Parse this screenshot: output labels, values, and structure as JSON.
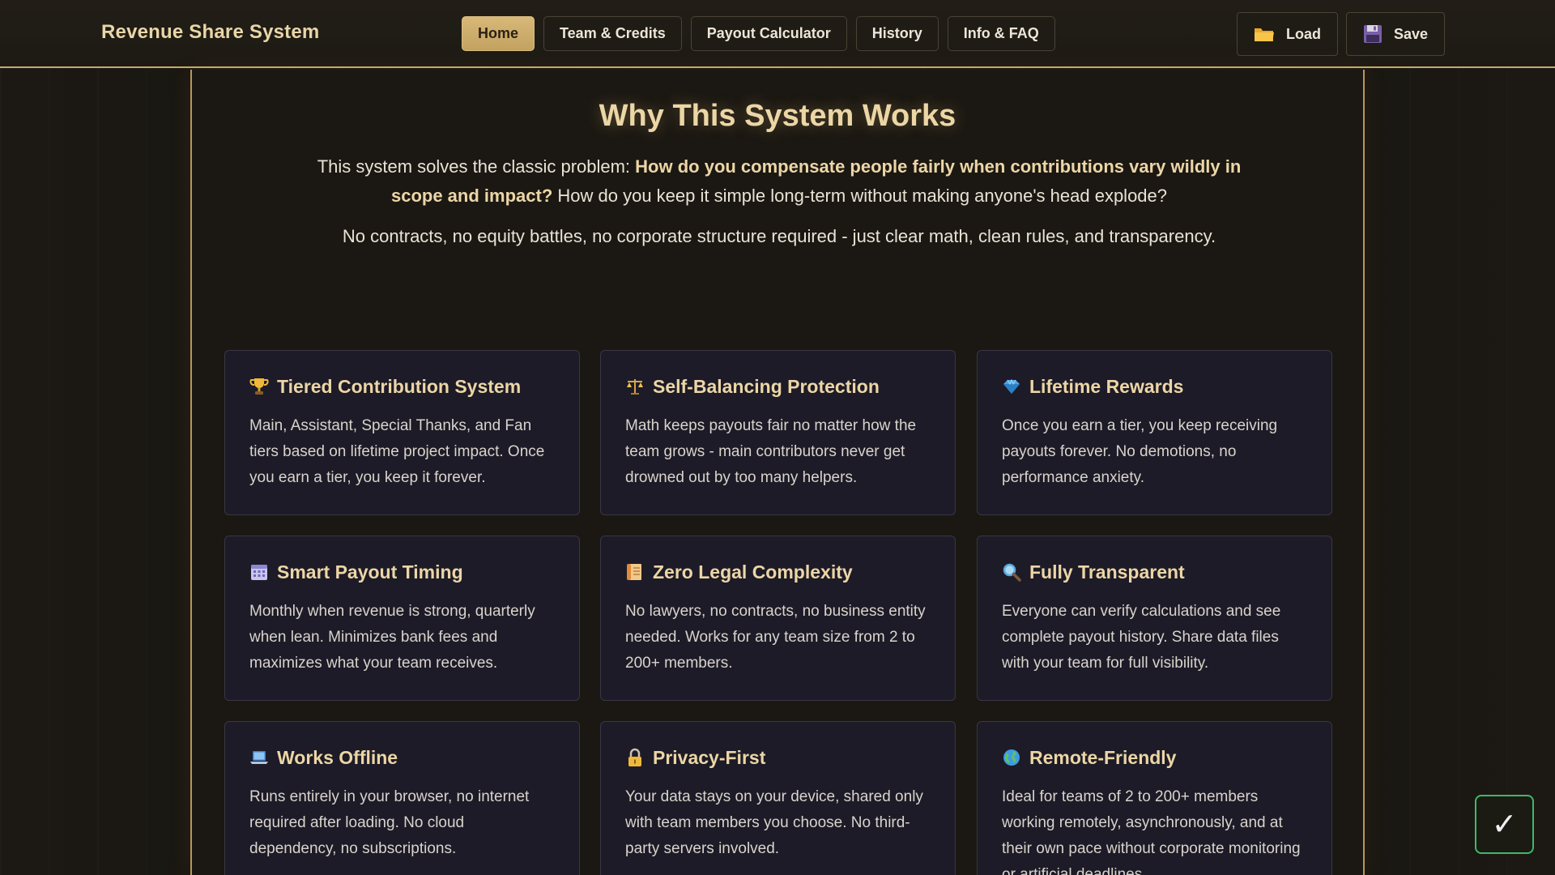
{
  "header": {
    "brand": "Revenue Share System",
    "nav": [
      {
        "label": "Home",
        "active": true
      },
      {
        "label": "Team & Credits",
        "active": false
      },
      {
        "label": "Payout Calculator",
        "active": false
      },
      {
        "label": "History",
        "active": false
      },
      {
        "label": "Info & FAQ",
        "active": false
      }
    ],
    "actions": {
      "load_label": "Load",
      "load_icon": "folder-icon",
      "save_label": "Save",
      "save_icon": "floppy-disk-icon"
    }
  },
  "main": {
    "title": "Why This System Works",
    "intro_lead": "This system solves the classic problem: ",
    "intro_bold": "How do you compensate people fairly when contributions vary wildly in scope and impact?",
    "intro_tail": " How do you keep it simple long-term without making anyone's head explode?",
    "intro2": "No contracts, no equity battles, no corporate structure required - just clear math, clean rules, and transparency.",
    "features": [
      {
        "icon": "trophy-icon",
        "title": "Tiered Contribution System",
        "text": "Main, Assistant, Special Thanks, and Fan tiers based on lifetime project impact. Once you earn a tier, you keep it forever."
      },
      {
        "icon": "scales-icon",
        "title": "Self-Balancing Protection",
        "text": "Math keeps payouts fair no matter how the team grows - main contributors never get drowned out by too many helpers."
      },
      {
        "icon": "diamond-icon",
        "title": "Lifetime Rewards",
        "text": "Once you earn a tier, you keep receiving payouts forever. No demotions, no performance anxiety."
      },
      {
        "icon": "calendar-icon",
        "title": "Smart Payout Timing",
        "text": "Monthly when revenue is strong, quarterly when lean. Minimizes bank fees and maximizes what your team receives."
      },
      {
        "icon": "scroll-icon",
        "title": "Zero Legal Complexity",
        "text": "No lawyers, no contracts, no business entity needed. Works for any team size from 2 to 200+ members."
      },
      {
        "icon": "magnifier-icon",
        "title": "Fully Transparent",
        "text": "Everyone can verify calculations and see complete payout history. Share data files with your team for full visibility."
      },
      {
        "icon": "laptop-icon",
        "title": "Works Offline",
        "text": "Runs entirely in your browser, no internet required after loading. No cloud dependency, no subscriptions."
      },
      {
        "icon": "lock-icon",
        "title": "Privacy-First",
        "text": "Your data stays on your device, shared only with team members you choose. No third-party servers involved."
      },
      {
        "icon": "globe-icon",
        "title": "Remote-Friendly",
        "text": "Ideal for teams of 2 to 200+ members working remotely, asynchronously, and at their own pace without corporate monitoring or artificial deadlines."
      }
    ]
  },
  "toast": {
    "icon": "checkmark-icon",
    "symbol": "✓"
  },
  "colors": {
    "accent": "#c9a867",
    "title": "#ecd6a6",
    "card_bg": "#1d1b27",
    "success": "#3fb86a"
  }
}
